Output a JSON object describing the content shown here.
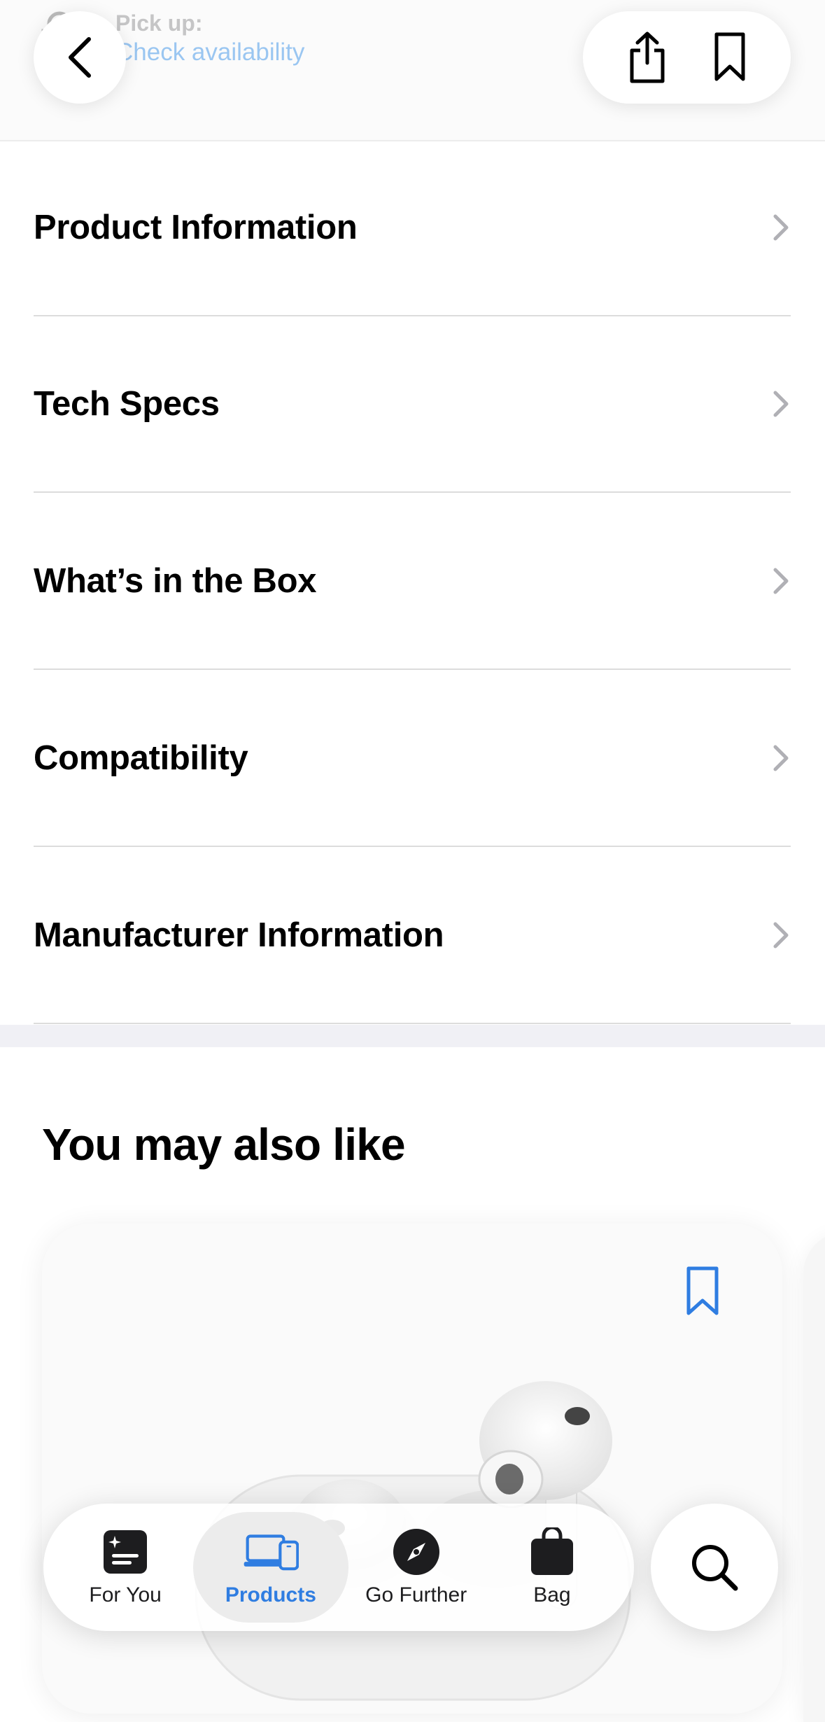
{
  "header": {
    "pickup_label": "Pick up:",
    "pickup_link": "Check availability"
  },
  "sections": [
    {
      "label": "Product Information"
    },
    {
      "label": "Tech Specs"
    },
    {
      "label": "What’s in the Box"
    },
    {
      "label": "Compatibility"
    },
    {
      "label": "Manufacturer Information"
    }
  ],
  "recommendations": {
    "title": "You may also like"
  },
  "tabbar": {
    "tabs": [
      {
        "label": "For You",
        "icon": "for-you-icon",
        "selected": false
      },
      {
        "label": "Products",
        "icon": "products-icon",
        "selected": true
      },
      {
        "label": "Go Further",
        "icon": "compass-icon",
        "selected": false
      },
      {
        "label": "Bag",
        "icon": "bag-icon",
        "selected": false
      }
    ]
  },
  "colors": {
    "accent": "#2f7de1",
    "link": "#0071e3",
    "divider": "#dcdcdc"
  }
}
